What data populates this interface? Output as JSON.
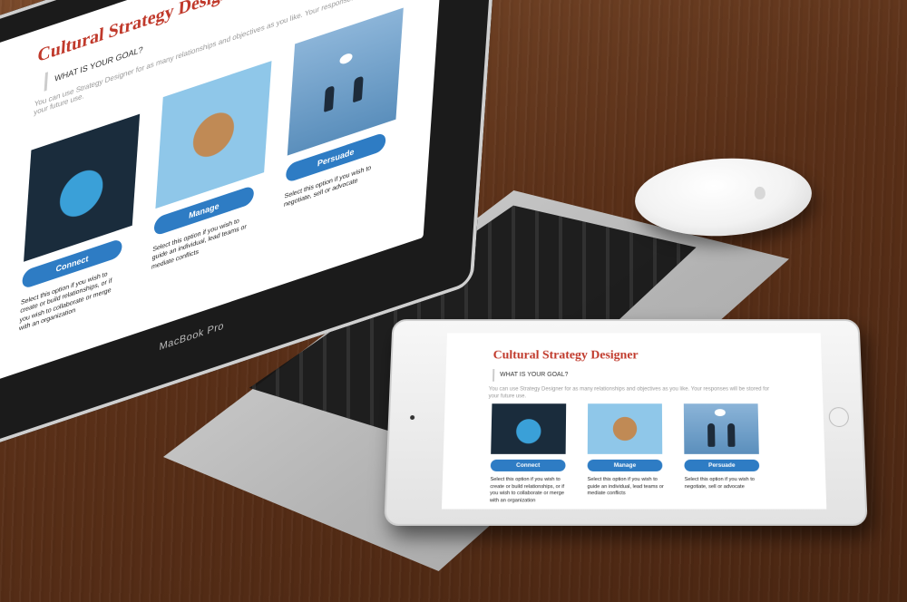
{
  "laptop": {
    "model_label": "MacBook Pro",
    "page": {
      "title": "Cultural Strategy Designer",
      "goal_heading": "WHAT IS YOUR GOAL?",
      "intro": "You can use Strategy Designer for as many relationships and objectives as you like. Your responses will be stored for your future use.",
      "options": [
        {
          "label": "Connect",
          "description": "Select this option if you wish to create or build relationships, or if you wish to collaborate or merge with an organization",
          "art": "globe-network-illustration"
        },
        {
          "label": "Manage",
          "description": "Select this option if you wish to guide an individual, lead teams or mediate conflicts",
          "art": "team-table-illustration"
        },
        {
          "label": "Persuade",
          "description": "Select this option if you wish to negotiate, sell or advocate",
          "art": "handshake-illustration"
        }
      ]
    }
  },
  "tablet": {
    "page": {
      "title": "Cultural Strategy Designer",
      "goal_heading": "WHAT IS YOUR GOAL?",
      "intro": "You can use Strategy Designer for as many relationships and objectives as you like. Your responses will be stored for your future use.",
      "options": [
        {
          "label": "Connect",
          "description": "Select this option if you wish to create or build relationships, or if you wish to collaborate or merge with an organization",
          "art": "globe-network-illustration"
        },
        {
          "label": "Manage",
          "description": "Select this option if you wish to guide an individual, lead teams or mediate conflicts",
          "art": "team-table-illustration"
        },
        {
          "label": "Persuade",
          "description": "Select this option if you wish to negotiate, sell or advocate",
          "art": "handshake-illustration"
        }
      ]
    }
  },
  "colors": {
    "title": "#c0392b",
    "button": "#2e7cc4",
    "desk": "#5a3018"
  }
}
